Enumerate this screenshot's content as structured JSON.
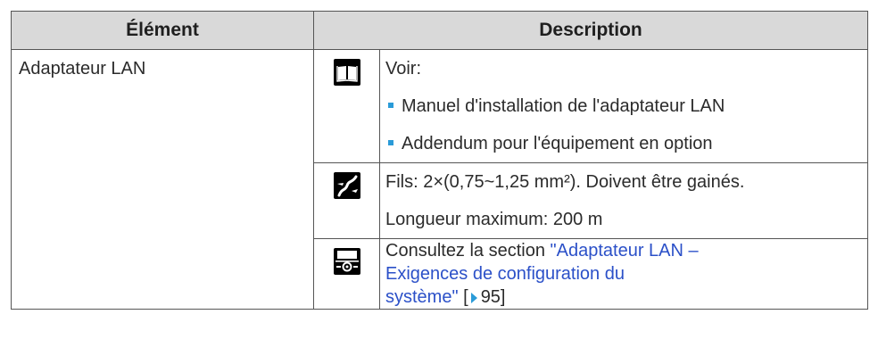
{
  "headers": {
    "element": "Élément",
    "description": "Description"
  },
  "row": {
    "element": "Adaptateur LAN",
    "book": {
      "icon": "manual-book-icon",
      "intro": "Voir:",
      "items": [
        "Manuel d'installation de l'adaptateur LAN",
        "Addendum pour l'équipement en option"
      ]
    },
    "wiring": {
      "icon": "wire-cable-icon",
      "line1": "Fils: 2×(0,75~1,25 mm²). Doivent être gainés.",
      "line2": "Longueur maximum: 200 m"
    },
    "config": {
      "icon": "user-interface-settings-icon",
      "prefix": "Consultez la section ",
      "link_line1": "\"Adaptateur LAN –",
      "link_line2": "Exigences de configuration du",
      "link_line3": "système\"",
      "bracket_open": "[",
      "page": "95]"
    }
  },
  "colors": {
    "header_bg": "#d9d9d9",
    "link": "#2b50c8",
    "bullet": "#2a9bd8"
  }
}
